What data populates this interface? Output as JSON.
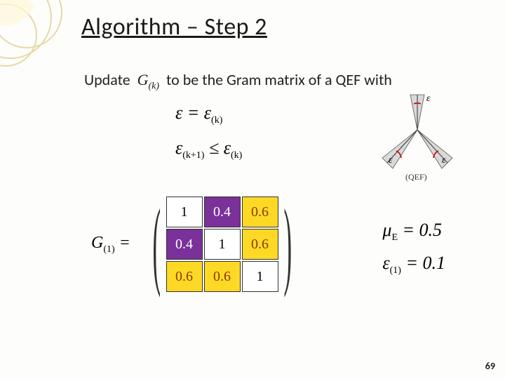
{
  "title": "Algorithm – Step 2",
  "body": {
    "update": "Update",
    "g_label": "G",
    "g_sub": "(k)",
    "rest": "to be the Gram matrix of a QEF with"
  },
  "equations": {
    "line1_left": "ε",
    "line1_eq": " = ",
    "line1_right": "ε",
    "line1_right_sub": "(k)",
    "line2_left": "ε",
    "line2_left_sub": "(k+1)",
    "line2_rel": " ≤ ",
    "line2_right": "ε",
    "line2_right_sub": "(k)"
  },
  "qef": {
    "eps": "ε",
    "label": "(QEF)"
  },
  "matrix": {
    "label": "G",
    "label_sub": "(1)",
    "eq": " = ",
    "cells": [
      [
        "1",
        "0.4",
        "0.6"
      ],
      [
        "0.4",
        "1",
        "0.6"
      ],
      [
        "0.6",
        "0.6",
        "1"
      ]
    ]
  },
  "side": {
    "mu": "μ",
    "mu_sub": "E",
    "mu_val": " = 0.5",
    "eps": "ε",
    "eps_sub": "(1)",
    "eps_val": " = 0.1"
  },
  "page_number": "69"
}
